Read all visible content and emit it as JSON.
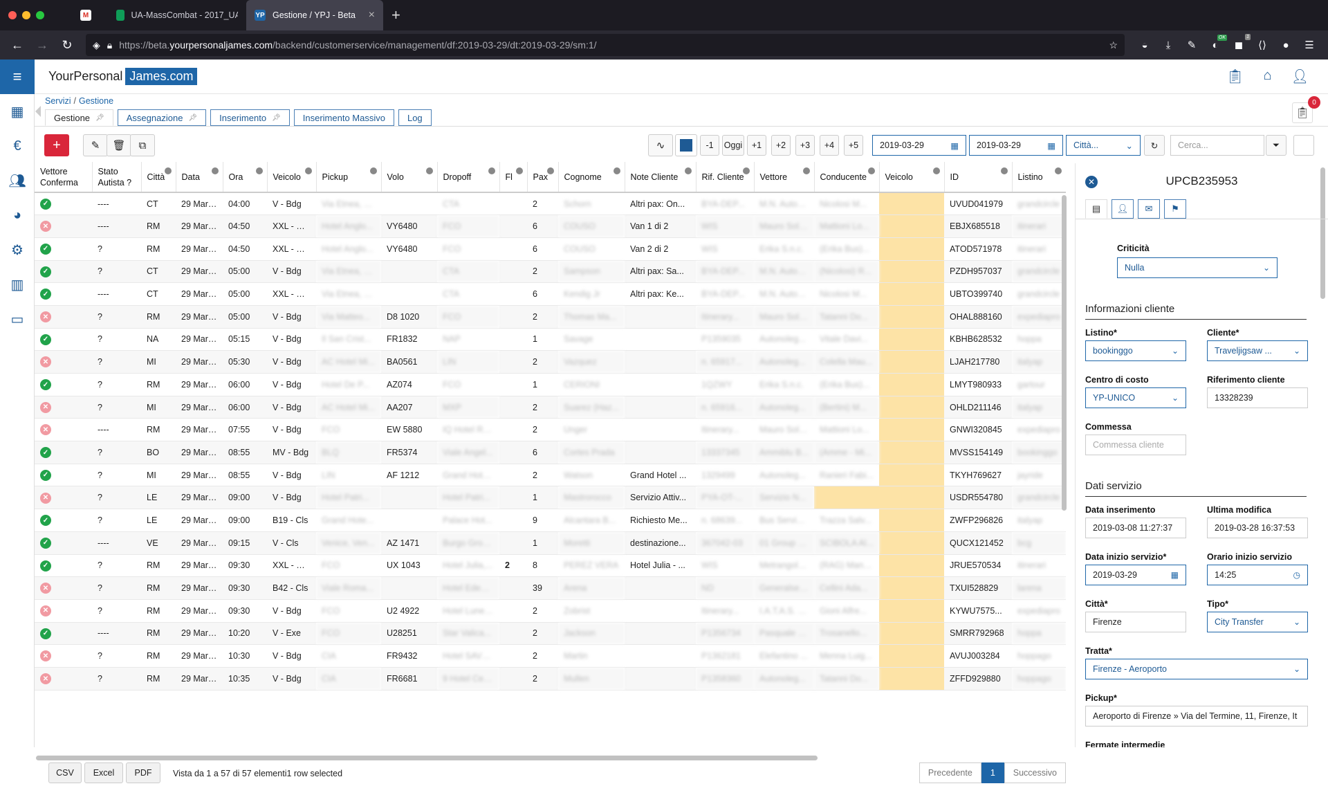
{
  "browser": {
    "tabs": [
      {
        "label": "",
        "icon": "gmail-icon"
      },
      {
        "label": "UA-MassCombat - 2017_UAMassCo..."
      },
      {
        "label": "Gestione / YPJ - Beta",
        "icon": "YP"
      }
    ],
    "url_prefix": "https://beta.",
    "url_domain": "yourpersonaljames.com",
    "url_path": "/backend/customerservice/management/df:2019-03-29/dt:2019-03-29/sm:1/",
    "ext_ok_badge": "OK",
    "ext_count_badge": "1"
  },
  "app": {
    "logo_left": "YourPersonal",
    "logo_right": "James.com",
    "breadcrumb": [
      "Servizi",
      "Gestione"
    ],
    "notification_count": "0",
    "tabs": [
      "Gestione",
      "Assegnazione",
      "Inserimento",
      "Inserimento Massivo",
      "Log"
    ],
    "toolbar": {
      "day_buttons": [
        "-1",
        "Oggi",
        "+1",
        "+2",
        "+3",
        "+4",
        "+5"
      ],
      "date_from": "2019-03-29",
      "date_to": "2019-03-29",
      "city_select": "Città...",
      "search_placeholder": "Cerca..."
    }
  },
  "table": {
    "columns": [
      "Vettore Conferma",
      "Stato Autista ?",
      "Città",
      "Data",
      "Ora",
      "Veicolo",
      "Pickup",
      "Volo",
      "Dropoff",
      "Fl",
      "Pax",
      "Cognome",
      "Note Cliente",
      "Rif. Cliente",
      "Vettore",
      "Conducente",
      "Veicolo",
      "ID",
      "Listino"
    ],
    "rows": [
      {
        "ok": true,
        "stato": "----",
        "citta": "CT",
        "data": "29 Mar ...",
        "ora": "04:00",
        "veicolo": "V - Bdg",
        "pickup": "Via Etnea, 2...",
        "volo": "",
        "dropoff": "CTA",
        "fl": "",
        "pax": "2",
        "cognome": "Schorn",
        "note": "Altri pax: On...",
        "rif": "BYA-DEP...",
        "vettore": "M.N. Autos...",
        "conducente": "Nicolosi M...",
        "veic2": "",
        "id": "UVUD041979",
        "listino": "grandcircle"
      },
      {
        "ok": false,
        "stato": "----",
        "citta": "RM",
        "data": "29 Mar ...",
        "ora": "04:50",
        "veicolo": "XXL - Bdg",
        "pickup": "Hotel Anglo...",
        "volo": "VY6480",
        "dropoff": "FCO",
        "fl": "",
        "pax": "6",
        "cognome": "COUSO",
        "note": "Van 1 di 2",
        "rif": "WIS",
        "vettore": "Mauro Sold...",
        "conducente": "Mattioni Lo...",
        "veic2": "",
        "id": "EBJX685518",
        "listino": "itinerari"
      },
      {
        "ok": true,
        "stato": "?",
        "citta": "RM",
        "data": "29 Mar ...",
        "ora": "04:50",
        "veicolo": "XXL - Bdg",
        "pickup": "Hotel Anglo...",
        "volo": "VY6480",
        "dropoff": "FCO",
        "fl": "",
        "pax": "6",
        "cognome": "COUSO",
        "note": "Van 2 di 2",
        "rif": "WIS",
        "vettore": "Erika S.n.c.",
        "conducente": "(Erika Bus)...",
        "veic2": "",
        "id": "ATOD571978",
        "listino": "itinerari"
      },
      {
        "ok": true,
        "stato": "?",
        "citta": "CT",
        "data": "29 Mar ...",
        "ora": "05:00",
        "veicolo": "V - Bdg",
        "pickup": "Via Etnea, 2...",
        "volo": "",
        "dropoff": "CTA",
        "fl": "",
        "pax": "2",
        "cognome": "Sampson",
        "note": "Altri pax: Sa...",
        "rif": "BYA-DEP...",
        "vettore": "M.N. Autos...",
        "conducente": "(Nicolosi) R...",
        "veic2": "",
        "id": "PZDH957037",
        "listino": "grandcircle"
      },
      {
        "ok": true,
        "stato": "----",
        "citta": "CT",
        "data": "29 Mar ...",
        "ora": "05:00",
        "veicolo": "XXL - Bdg",
        "pickup": "Via Etnea, 2...",
        "volo": "",
        "dropoff": "CTA",
        "fl": "",
        "pax": "6",
        "cognome": "Kendig Jr",
        "note": "Altri pax: Ke...",
        "rif": "BYA-DEP...",
        "vettore": "M.N. Autos...",
        "conducente": "Nicolosi M...",
        "veic2": "",
        "id": "UBTO399740",
        "listino": "grandcircle"
      },
      {
        "ok": false,
        "stato": "?",
        "citta": "RM",
        "data": "29 Mar ...",
        "ora": "05:00",
        "veicolo": "V - Bdg",
        "pickup": "Via Matteo...",
        "volo": "D8 1020",
        "dropoff": "FCO",
        "fl": "",
        "pax": "2",
        "cognome": "Thomas Ma...",
        "note": "",
        "rif": "Itinerary...",
        "vettore": "Mauro Sold...",
        "conducente": "Tatanni Do...",
        "veic2": "",
        "id": "OHAL888160",
        "listino": "expediapro"
      },
      {
        "ok": true,
        "stato": "?",
        "citta": "NA",
        "data": "29 Mar ...",
        "ora": "05:15",
        "veicolo": "V - Bdg",
        "pickup": "Il San Crist...",
        "volo": "FR1832",
        "dropoff": "NAP",
        "fl": "",
        "pax": "1",
        "cognome": "Savage",
        "note": "",
        "rif": "P1359035",
        "vettore": "Autonoleg...",
        "conducente": "Vitale Davi...",
        "veic2": "",
        "id": "KBHB628532",
        "listino": "hoppa"
      },
      {
        "ok": false,
        "stato": "?",
        "citta": "MI",
        "data": "29 Mar ...",
        "ora": "05:30",
        "veicolo": "V - Bdg",
        "pickup": "AC Hotel Mi...",
        "volo": "BA0561",
        "dropoff": "LIN",
        "fl": "",
        "pax": "2",
        "cognome": "Vazquez",
        "note": "",
        "rif": "n. 65917...",
        "vettore": "Autonoleg...",
        "conducente": "Colella Mau...",
        "veic2": "",
        "id": "LJAH217780",
        "listino": "italyap"
      },
      {
        "ok": true,
        "stato": "?",
        "citta": "RM",
        "data": "29 Mar ...",
        "ora": "06:00",
        "veicolo": "V - Bdg",
        "pickup": "Hotel De P...",
        "volo": "AZ074",
        "dropoff": "FCO",
        "fl": "",
        "pax": "1",
        "cognome": "CERIONI",
        "note": "",
        "rif": "1QZWY",
        "vettore": "Erika S.n.c.",
        "conducente": "(Erika Bus)...",
        "veic2": "",
        "id": "LMYT980933",
        "listino": "gartour"
      },
      {
        "ok": false,
        "stato": "?",
        "citta": "MI",
        "data": "29 Mar ...",
        "ora": "06:00",
        "veicolo": "V - Bdg",
        "pickup": "AC Hotel Mi...",
        "volo": "AA207",
        "dropoff": "MXP",
        "fl": "",
        "pax": "2",
        "cognome": "Suarez (Haz...",
        "note": "",
        "rif": "n. 65916...",
        "vettore": "Autonoleg...",
        "conducente": "(Bertini) M...",
        "veic2": "",
        "id": "OHLD211146",
        "listino": "italyap"
      },
      {
        "ok": false,
        "stato": "----",
        "citta": "RM",
        "data": "29 Mar ...",
        "ora": "07:55",
        "veicolo": "V - Bdg",
        "pickup": "FCO",
        "volo": "EW 5880",
        "dropoff": "IQ Hotel Ro...",
        "fl": "",
        "pax": "2",
        "cognome": "Unger",
        "note": "",
        "rif": "Itinerary...",
        "vettore": "Mauro Sold...",
        "conducente": "Mattioni Lo...",
        "veic2": "",
        "id": "GNWI320845",
        "listino": "expediapro"
      },
      {
        "ok": true,
        "stato": "?",
        "citta": "BO",
        "data": "29 Mar ...",
        "ora": "08:55",
        "veicolo": "MV - Bdg",
        "pickup": "BLQ",
        "volo": "FR5374",
        "dropoff": "Viale Angel...",
        "fl": "",
        "pax": "6",
        "cognome": "Cortes Prada",
        "note": "",
        "rif": "13337345",
        "vettore": "Ammiblu B...",
        "conducente": "(Amme - Mi...",
        "veic2": "",
        "id": "MVSS154149",
        "listino": "bookinggo"
      },
      {
        "ok": true,
        "stato": "?",
        "citta": "MI",
        "data": "29 Mar ...",
        "ora": "08:55",
        "veicolo": "V - Bdg",
        "pickup": "LIN",
        "volo": "AF 1212",
        "dropoff": "Grand Hote...",
        "fl": "",
        "pax": "2",
        "cognome": "Watson",
        "note": "Grand Hotel ...",
        "rif": "1329499",
        "vettore": "Autonoleg...",
        "conducente": "Ranieri Fabi...",
        "veic2": "",
        "id": "TKYH769627",
        "listino": "jayride"
      },
      {
        "ok": false,
        "stato": "?",
        "citta": "LE",
        "data": "29 Mar ...",
        "ora": "09:00",
        "veicolo": "V - Bdg",
        "pickup": "Hotel Patri...",
        "volo": "",
        "dropoff": "Hotel Patri...",
        "fl": "",
        "pax": "1",
        "cognome": "Mastrorocco",
        "note": "Servizio Attiv...",
        "rif": "PYA-OT-...",
        "vettore": "Servizio N...",
        "conducente": "",
        "veic2": "",
        "id": "USDR554780",
        "listino": "grandcircle",
        "wide": true
      },
      {
        "ok": true,
        "stato": "?",
        "citta": "LE",
        "data": "29 Mar ...",
        "ora": "09:00",
        "veicolo": "B19 - Cls",
        "pickup": "Grand Hote...",
        "volo": "",
        "dropoff": "Palace Hot...",
        "fl": "",
        "pax": "9",
        "cognome": "Alcantara B...",
        "note": "Richiesto Me...",
        "rif": "n. 68639...",
        "vettore": "Bus Service...",
        "conducente": "Trazza Salv...",
        "veic2": "",
        "id": "ZWFP296826",
        "listino": "italyap"
      },
      {
        "ok": true,
        "stato": "----",
        "citta": "VE",
        "data": "29 Mar ...",
        "ora": "09:15",
        "veicolo": "V - Cls",
        "pickup": "Venice, Ven...",
        "volo": "AZ 1471",
        "dropoff": "Burgo Grou...",
        "fl": "",
        "pax": "1",
        "cognome": "Moretti",
        "note": "destinazione...",
        "rif": "367042-03",
        "vettore": "01 Group V...",
        "conducente": "SCIBOLA Al...",
        "veic2": "",
        "id": "QUCX121452",
        "listino": "bcg"
      },
      {
        "ok": true,
        "stato": "?",
        "citta": "RM",
        "data": "29 Mar ...",
        "ora": "09:30",
        "veicolo": "XXL - Bdg",
        "pickup": "FCO",
        "volo": "UX 1043",
        "dropoff": "Hotel Julia,...",
        "fl": "2",
        "pax": "8",
        "cognome": "PEREZ VERA",
        "note": "Hotel Julia - ...",
        "rif": "WIS",
        "vettore": "Metrangolo...",
        "conducente": "(RAG) Manu...",
        "veic2": "",
        "id": "JRUE570534",
        "listino": "itinerari"
      },
      {
        "ok": false,
        "stato": "?",
        "citta": "RM",
        "data": "29 Mar ...",
        "ora": "09:30",
        "veicolo": "B42 - Cls",
        "pickup": "Viale Roma...",
        "volo": "",
        "dropoff": "Hotel Eden,...",
        "fl": "",
        "pax": "39",
        "cognome": "Arena",
        "note": "",
        "rif": "ND",
        "vettore": "Generalser...",
        "conducente": "Cellini Ada...",
        "veic2": "",
        "id": "TXUI528829",
        "listino": "larena"
      },
      {
        "ok": false,
        "stato": "?",
        "citta": "RM",
        "data": "29 Mar ...",
        "ora": "09:30",
        "veicolo": "V - Bdg",
        "pickup": "FCO",
        "volo": "U2 4922",
        "dropoff": "Hotel Lunet...",
        "fl": "",
        "pax": "2",
        "cognome": "Zobrist",
        "note": "",
        "rif": "Itinerary...",
        "vettore": "I.A.T.A.S. Sa...",
        "conducente": "Gioni Alfre...",
        "veic2": "",
        "id": "KYWU7575...",
        "listino": "expediapro"
      },
      {
        "ok": true,
        "stato": "----",
        "citta": "RM",
        "data": "29 Mar ...",
        "ora": "10:20",
        "veicolo": "V - Exe",
        "pickup": "FCO",
        "volo": "U28251",
        "dropoff": "Star Valica...",
        "fl": "",
        "pax": "2",
        "cognome": "Jackson",
        "note": "",
        "rif": "P1356734",
        "vettore": "Pasquale Tr...",
        "conducente": "Trosanello...",
        "veic2": "",
        "id": "SMRR792968",
        "listino": "hoppa"
      },
      {
        "ok": false,
        "stato": "?",
        "citta": "RM",
        "data": "29 Mar ...",
        "ora": "10:30",
        "veicolo": "V - Bdg",
        "pickup": "CIA",
        "volo": "FR9432",
        "dropoff": "Hotel SAVO...",
        "fl": "",
        "pax": "2",
        "cognome": "Martin",
        "note": "",
        "rif": "P1362181",
        "vettore": "Elefantino ...",
        "conducente": "Menna Luig...",
        "veic2": "",
        "id": "AVUJ003284",
        "listino": "hoppago"
      },
      {
        "ok": false,
        "stato": "?",
        "citta": "RM",
        "data": "29 Mar ...",
        "ora": "10:35",
        "veicolo": "V - Bdg",
        "pickup": "CIA",
        "volo": "FR6681",
        "dropoff": "9 Hotel Ces...",
        "fl": "",
        "pax": "2",
        "cognome": "Mullen",
        "note": "",
        "rif": "P1358360",
        "vettore": "Autonoleg...",
        "conducente": "Tatanni Do...",
        "veic2": "",
        "id": "ZFFD929880",
        "listino": "hoppago"
      }
    ]
  },
  "footer": {
    "export": [
      "CSV",
      "Excel",
      "PDF"
    ],
    "info": "Vista da 1 a 57 di 57 elementi1 row selected",
    "prev": "Precedente",
    "page": "1",
    "next": "Successivo"
  },
  "detail": {
    "title": "UPCB235953",
    "criticita_label": "Criticità",
    "criticita_value": "Nulla",
    "section_cliente": "Informazioni cliente",
    "listino_label": "Listino*",
    "listino_value": "bookinggo",
    "cliente_label": "Cliente*",
    "cliente_value": "Traveljigsaw ...",
    "centro_label": "Centro di costo",
    "centro_value": "YP-UNICO",
    "rif_label": "Riferimento cliente",
    "rif_value": "13328239",
    "commessa_label": "Commessa",
    "commessa_placeholder": "Commessa cliente",
    "section_servizio": "Dati servizio",
    "data_ins_label": "Data inserimento",
    "data_ins_value": "2019-03-08 11:27:37",
    "ultima_label": "Ultima modifica",
    "ultima_value": "2019-03-28 16:37:53",
    "data_inizio_label": "Data inizio servizio*",
    "data_inizio_value": "2019-03-29",
    "orario_label": "Orario inizio servizio",
    "orario_value": "14:25",
    "citta_label": "Città*",
    "citta_value": "Firenze",
    "tipo_label": "Tipo*",
    "tipo_value": "City Transfer",
    "tratta_label": "Tratta*",
    "tratta_value": "Firenze - Aeroporto",
    "pickup_label": "Pickup*",
    "pickup_value": "Aeroporto di Firenze » Via del Termine, 11, Firenze, It",
    "fermate_label": "Fermate intermedie"
  },
  "colors": {
    "accent": "#1e66a8",
    "danger": "#d9263a",
    "ok": "#21a34a",
    "ko": "#f19aa2",
    "vehicle_highlight": "#fde3a6"
  }
}
